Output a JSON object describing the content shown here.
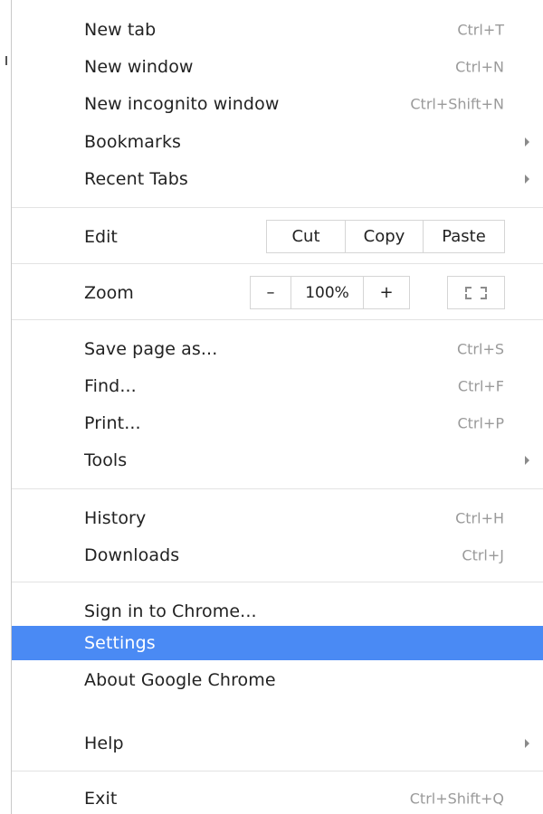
{
  "colors": {
    "highlight": "#4a8af4",
    "text": "#222222",
    "shortcut_text": "#9a9a9a",
    "separator": "#e3e3e3",
    "button_border": "#d5d5d5"
  },
  "menu": {
    "new_tab": {
      "label": "New tab",
      "shortcut": "Ctrl+T"
    },
    "new_window": {
      "label": "New window",
      "shortcut": "Ctrl+N"
    },
    "new_incognito": {
      "label": "New incognito window",
      "shortcut": "Ctrl+Shift+N"
    },
    "bookmarks": {
      "label": "Bookmarks"
    },
    "recent_tabs": {
      "label": "Recent Tabs"
    },
    "edit": {
      "label": "Edit",
      "cut": "Cut",
      "copy": "Copy",
      "paste": "Paste"
    },
    "zoom": {
      "label": "Zoom",
      "minus": "–",
      "value": "100%",
      "plus": "+",
      "fullscreen_icon": "fullscreen-icon"
    },
    "save_page": {
      "label": "Save page as...",
      "shortcut": "Ctrl+S"
    },
    "find": {
      "label": "Find...",
      "shortcut": "Ctrl+F"
    },
    "print": {
      "label": "Print...",
      "shortcut": "Ctrl+P"
    },
    "tools": {
      "label": "Tools"
    },
    "history": {
      "label": "History",
      "shortcut": "Ctrl+H"
    },
    "downloads": {
      "label": "Downloads",
      "shortcut": "Ctrl+J"
    },
    "sign_in": {
      "label": "Sign in to Chrome..."
    },
    "settings": {
      "label": "Settings",
      "highlighted": true
    },
    "about": {
      "label": "About Google Chrome"
    },
    "help": {
      "label": "Help"
    },
    "exit": {
      "label": "Exit",
      "shortcut": "Ctrl+Shift+Q"
    }
  }
}
